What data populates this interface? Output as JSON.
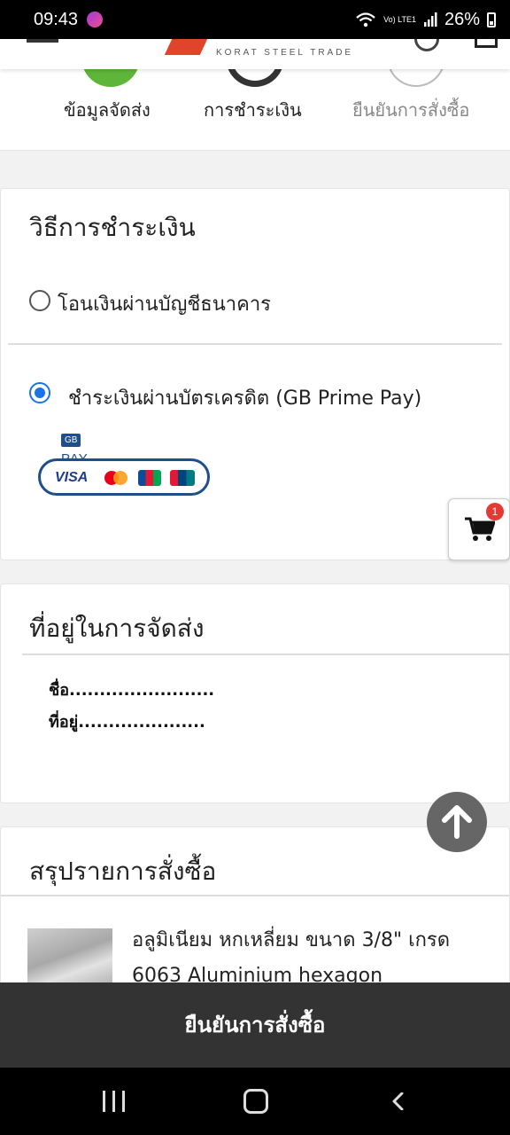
{
  "status_bar": {
    "time": "09:43",
    "network": "Vo) LTE1",
    "battery": "26%"
  },
  "header": {
    "logo_text": "KORAT STEEL TRADE"
  },
  "steps": [
    {
      "label": "ข้อมูลจัดส่ง",
      "state": "done",
      "color": "#5db53a"
    },
    {
      "label": "การชำระเงิน",
      "state": "current",
      "color": "#333333"
    },
    {
      "label": "ยืนยันการสั่งซื้อ",
      "state": "pending",
      "color": "#888888"
    }
  ],
  "payment": {
    "title": "วิธีการชำระเงิน",
    "options": [
      {
        "label": "โอนเงินผ่านบัญชีธนาคาร",
        "selected": false
      },
      {
        "label": "ชำระเงินผ่านบัตรเครดิต (GB Prime Pay)",
        "selected": true
      }
    ],
    "gb_logo": {
      "badge": "GB",
      "pay": "PAY",
      "visa": "VISA"
    }
  },
  "floating_cart": {
    "count": "1"
  },
  "address": {
    "title": "ที่อยู่ในการจัดส่ง",
    "name_line": "ชื่อ........................",
    "address_line": "ที่อยู่....................."
  },
  "summary": {
    "title": "สรุปรายการสั่งซื้อ",
    "product_name": "อลูมิเนียม หกเหลี่ยม ขนาด 3/8\" เกรด 6063 Aluminium hexagon"
  },
  "confirm_button": "ยืนยันการสั่งซื้อ",
  "colors": {
    "accent_blue": "#1a73e8",
    "confirm_bg": "#333333",
    "badge_red": "#e53935"
  }
}
